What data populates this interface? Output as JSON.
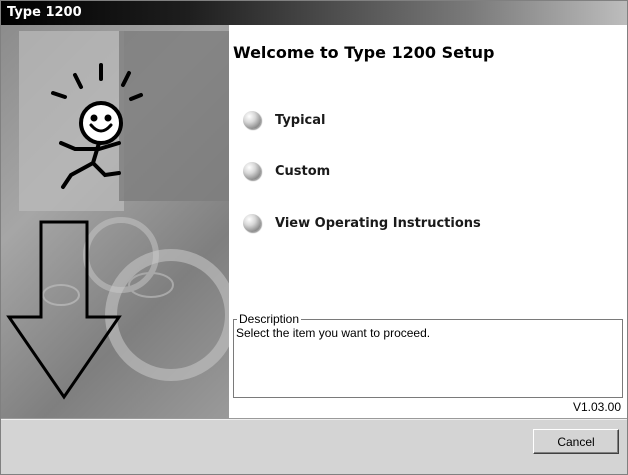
{
  "window": {
    "title": "Type 1200"
  },
  "main": {
    "heading": "Welcome to Type 1200 Setup",
    "options": [
      {
        "label": "Typical",
        "icon": "radio-bullet-icon"
      },
      {
        "label": "Custom",
        "icon": "radio-bullet-icon"
      },
      {
        "label": "View Operating Instructions",
        "icon": "radio-bullet-icon"
      }
    ],
    "description": {
      "legend": "Description",
      "text": "Select the item you want to proceed."
    },
    "version": "V1.03.00"
  },
  "footer": {
    "cancel_label": "Cancel"
  },
  "colors": {
    "titlebar_start": "#000000",
    "titlebar_end": "#bdbdbd",
    "dialog_bg": "#d4d4d4",
    "content_bg": "#ffffff"
  }
}
